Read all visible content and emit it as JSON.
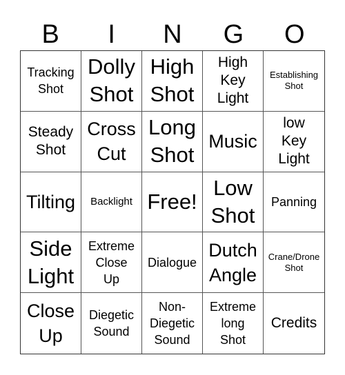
{
  "header": {
    "letters": [
      "B",
      "I",
      "N",
      "G",
      "O"
    ]
  },
  "cells": [
    {
      "text": "Tracking\nShot",
      "size": "s-s"
    },
    {
      "text": "Dolly\nShot",
      "size": "s-xl"
    },
    {
      "text": "High\nShot",
      "size": "s-xl"
    },
    {
      "text": "High\nKey\nLight",
      "size": "s-m"
    },
    {
      "text": "Establishing\nShot",
      "size": "s-xxs"
    },
    {
      "text": "Steady\nShot",
      "size": "s-m"
    },
    {
      "text": "Cross\nCut",
      "size": "s-l"
    },
    {
      "text": "Long\nShot",
      "size": "s-xl"
    },
    {
      "text": "Music",
      "size": "s-l"
    },
    {
      "text": "low\nKey\nLight",
      "size": "s-m"
    },
    {
      "text": "Tilting",
      "size": "s-l"
    },
    {
      "text": "Backlight",
      "size": "s-xs"
    },
    {
      "text": "Free!",
      "size": "s-xl"
    },
    {
      "text": "Low\nShot",
      "size": "s-xl"
    },
    {
      "text": "Panning",
      "size": "s-s"
    },
    {
      "text": "Side\nLight",
      "size": "s-xl"
    },
    {
      "text": "Extreme\nClose\nUp",
      "size": "s-s"
    },
    {
      "text": "Dialogue",
      "size": "s-s"
    },
    {
      "text": "Dutch\nAngle",
      "size": "s-l"
    },
    {
      "text": "Crane/Drone\nShot",
      "size": "s-xxs"
    },
    {
      "text": "Close\nUp",
      "size": "s-l"
    },
    {
      "text": "Diegetic\nSound",
      "size": "s-s"
    },
    {
      "text": "Non-\nDiegetic\nSound",
      "size": "s-s"
    },
    {
      "text": "Extreme\nlong\nShot",
      "size": "s-s"
    },
    {
      "text": "Credits",
      "size": "s-m"
    }
  ]
}
